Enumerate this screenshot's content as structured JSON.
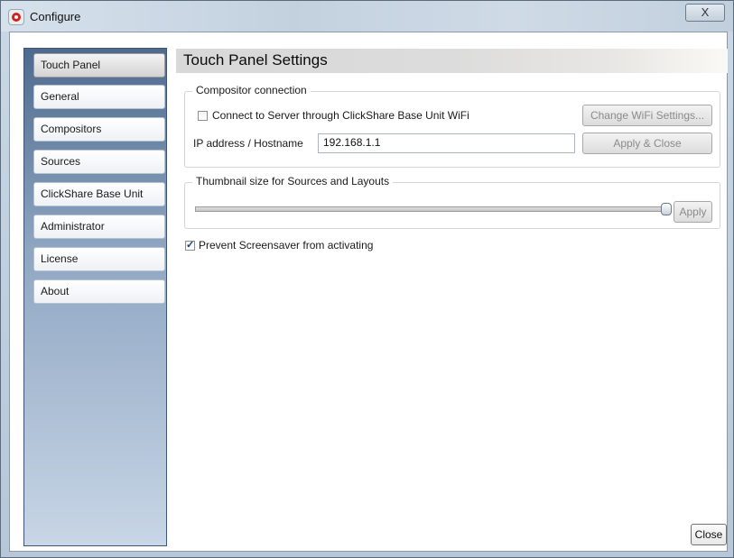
{
  "window": {
    "title": "Configure",
    "close_glyph": "X"
  },
  "sidebar": {
    "items": [
      {
        "label": "Touch Panel",
        "active": true
      },
      {
        "label": "General",
        "active": false
      },
      {
        "label": "Compositors",
        "active": false
      },
      {
        "label": "Sources",
        "active": false
      },
      {
        "label": "ClickShare Base Unit",
        "active": false
      },
      {
        "label": "Administrator",
        "active": false
      },
      {
        "label": "License",
        "active": false
      },
      {
        "label": "About",
        "active": false
      }
    ]
  },
  "content": {
    "title": "Touch Panel Settings",
    "compositor": {
      "legend": "Compositor connection",
      "wifi_checkbox_label": "Connect to Server through ClickShare Base Unit WiFi",
      "wifi_checked": false,
      "change_wifi_button": "Change WiFi Settings...",
      "ip_label": "IP address / Hostname",
      "ip_value": "192.168.1.1",
      "apply_close_button": "Apply & Close"
    },
    "thumbnail": {
      "legend": "Thumbnail size for Sources and Layouts",
      "slider_value_fraction": 1.0,
      "apply_button": "Apply"
    },
    "screensaver": {
      "label": "Prevent Screensaver from activating",
      "checked": true
    },
    "close_button": "Close"
  },
  "icons": {
    "app": "clickshare-app-icon",
    "close": "close-icon"
  }
}
